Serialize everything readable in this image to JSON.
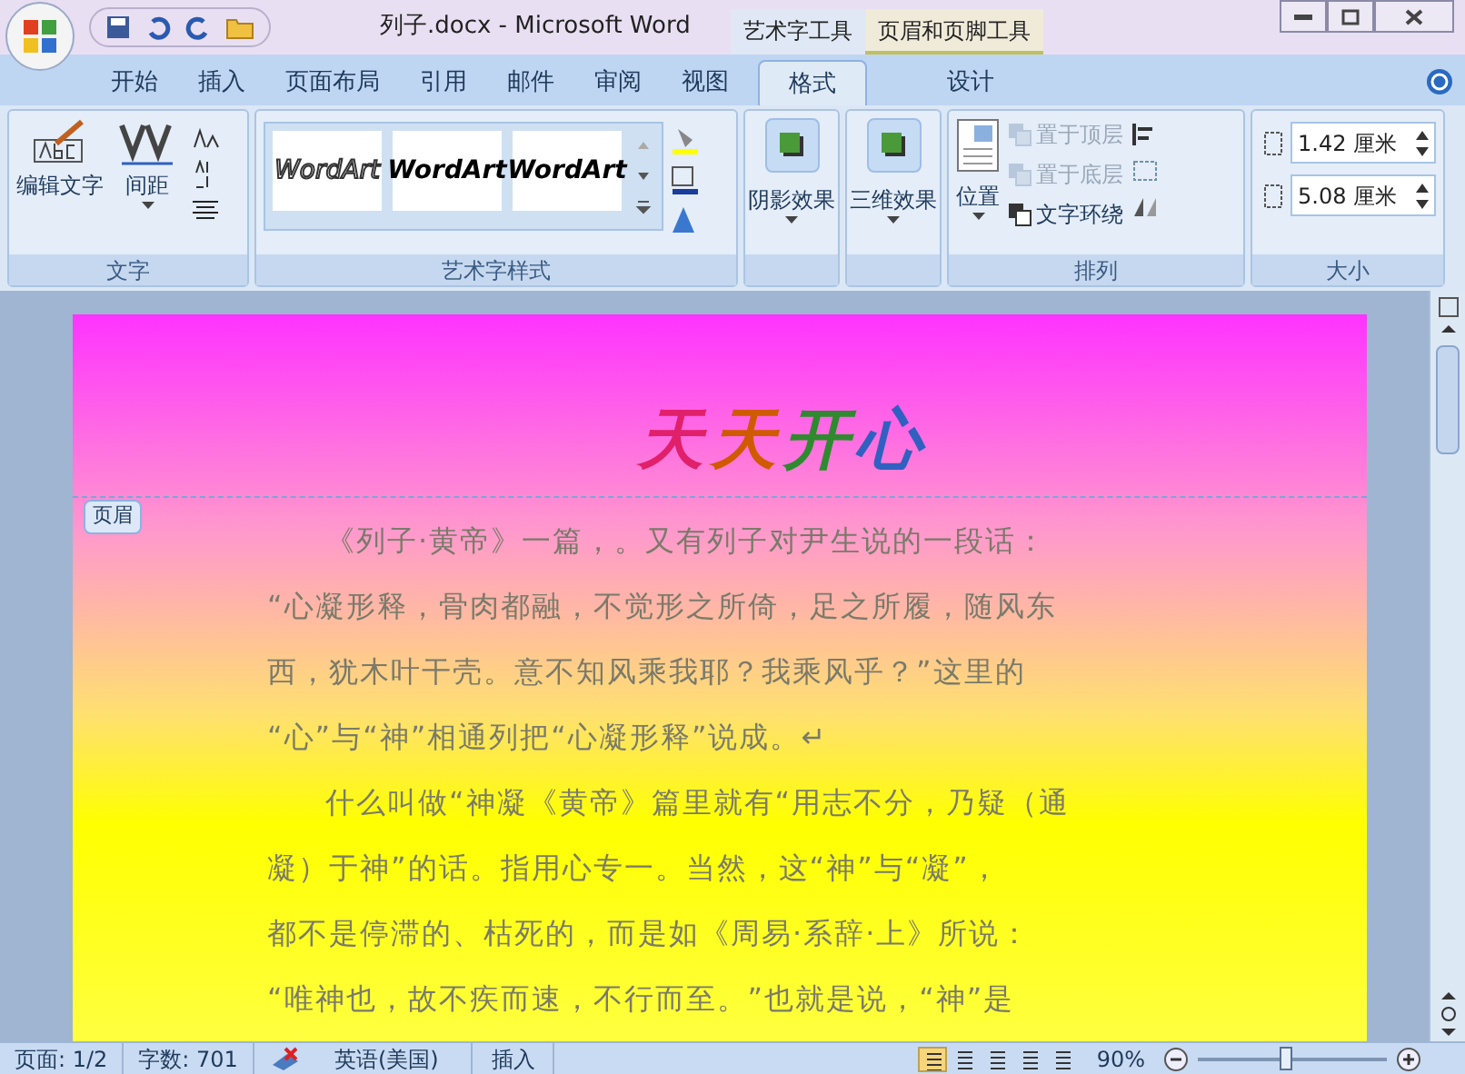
{
  "window": {
    "title": "列子.docx - Microsoft Word",
    "contextual_tabs": [
      {
        "label": "艺术字工具"
      },
      {
        "label": "页眉和页脚工具"
      }
    ]
  },
  "tabs": [
    {
      "label": "开始",
      "selected": false
    },
    {
      "label": "插入",
      "selected": false
    },
    {
      "label": "页面布局",
      "selected": false
    },
    {
      "label": "引用",
      "selected": false
    },
    {
      "label": "邮件",
      "selected": false
    },
    {
      "label": "审阅",
      "selected": false
    },
    {
      "label": "视图",
      "selected": false
    },
    {
      "label": "格式",
      "selected": true
    },
    {
      "label": "设计",
      "selected": false
    }
  ],
  "ribbon": {
    "text_group": {
      "label": "文字",
      "edit_text": "编辑文字",
      "spacing": "间距"
    },
    "wordart_styles": {
      "label": "艺术字样式",
      "samples": [
        "WordArt",
        "WordArt",
        "WordArt"
      ]
    },
    "shadow": "阴影效果",
    "three_d": "三维效果",
    "arrange": {
      "label": "排列",
      "position": "位置",
      "items": [
        {
          "label": "置于顶层",
          "disabled": true
        },
        {
          "label": "置于底层",
          "disabled": true
        },
        {
          "label": "文字环绕",
          "disabled": false
        }
      ]
    },
    "size": {
      "label": "大小",
      "height": "1.42 厘米",
      "width": "5.08 厘米"
    }
  },
  "document": {
    "header_wordart": "天天开心",
    "header_tag": "页眉",
    "lines": [
      {
        "text": "《列子·黄帝》一篇，。又有列子对尹生说的一段话：",
        "indent": true
      },
      {
        "text": "“心凝形释，骨肉都融，不觉形之所倚，足之所履，随风东",
        "indent": false
      },
      {
        "text": "西，犹木叶干壳。意不知风乘我耶？我乘风乎？”这里的",
        "indent": false
      },
      {
        "text": "“心”与“神”相通列把“心凝形释”说成。↵",
        "indent": false
      },
      {
        "text": "什么叫做“神凝《黄帝》篇里就有“用志不分，乃疑（通",
        "indent": true
      },
      {
        "text": "凝）于神”的话。指用心专一。当然，这“神”与“凝”，",
        "indent": false
      },
      {
        "text": "都不是停滞的、枯死的，而是如《周易·系辞·上》所说：",
        "indent": false
      },
      {
        "text": "“唯神也，故不疾而速，不行而至。”也就是说，“神”是",
        "indent": false
      }
    ]
  },
  "status_bar": {
    "page": "页面: 1/2",
    "words": "字数: 701",
    "language": "英语(美国)",
    "mode": "插入",
    "zoom": "90%",
    "zoom_slider": {
      "level": 0.46
    }
  }
}
